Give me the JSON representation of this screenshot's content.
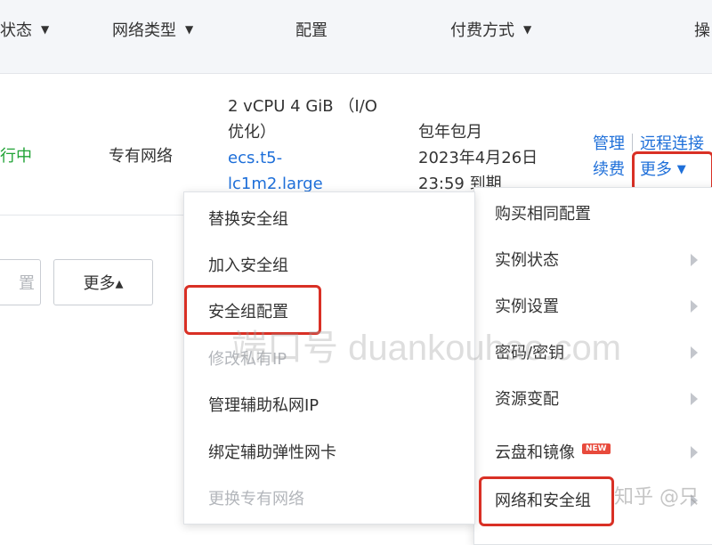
{
  "header": {
    "status": "状态",
    "network_type": "网络类型",
    "config": "配置",
    "billing": "付费方式",
    "ops": "操"
  },
  "row": {
    "status": "行中",
    "network": "专有网络",
    "config_line1": "2 vCPU 4 GiB （I/O",
    "config_line2": "优化）",
    "config_link1": "ecs.t5-",
    "config_link2": "lc1m2.large",
    "billing_line1": "包年包月",
    "billing_line2": "2023年4月26日",
    "billing_line3": "23:59 到期",
    "op_manage": "管理",
    "op_remote": "远程连接",
    "op_renew": "续费",
    "op_more": "更多"
  },
  "toolbar": {
    "left_btn": "置",
    "more_btn": "更多▴"
  },
  "submenu": {
    "items": [
      {
        "label": "替换安全组",
        "disabled": false
      },
      {
        "label": "加入安全组",
        "disabled": false
      },
      {
        "label": "安全组配置",
        "disabled": false
      },
      {
        "label": "修改私有IP",
        "disabled": true
      },
      {
        "label": "管理辅助私网IP",
        "disabled": false
      },
      {
        "label": "绑定辅助弹性网卡",
        "disabled": false
      },
      {
        "label": "更换专有网络",
        "disabled": true
      }
    ]
  },
  "main_menu": {
    "items": [
      {
        "label": "购买相同配置",
        "has_arrow": false
      },
      {
        "label": "实例状态",
        "has_arrow": true
      },
      {
        "label": "实例设置",
        "has_arrow": true
      },
      {
        "label": "密码/密钥",
        "has_arrow": true
      },
      {
        "label": "资源变配",
        "has_arrow": true
      },
      {
        "label": "云盘和镜像",
        "has_arrow": true,
        "badge": "NEW"
      },
      {
        "label": "网络和安全组",
        "has_arrow": true
      }
    ]
  },
  "watermark": {
    "brand": "端口号 duankouhao.com",
    "zhihu": "知乎 @只"
  },
  "colors": {
    "link": "#1e6fd9",
    "running": "#21a336",
    "highlight": "#d93025",
    "header_bg": "#f4f6f9"
  }
}
